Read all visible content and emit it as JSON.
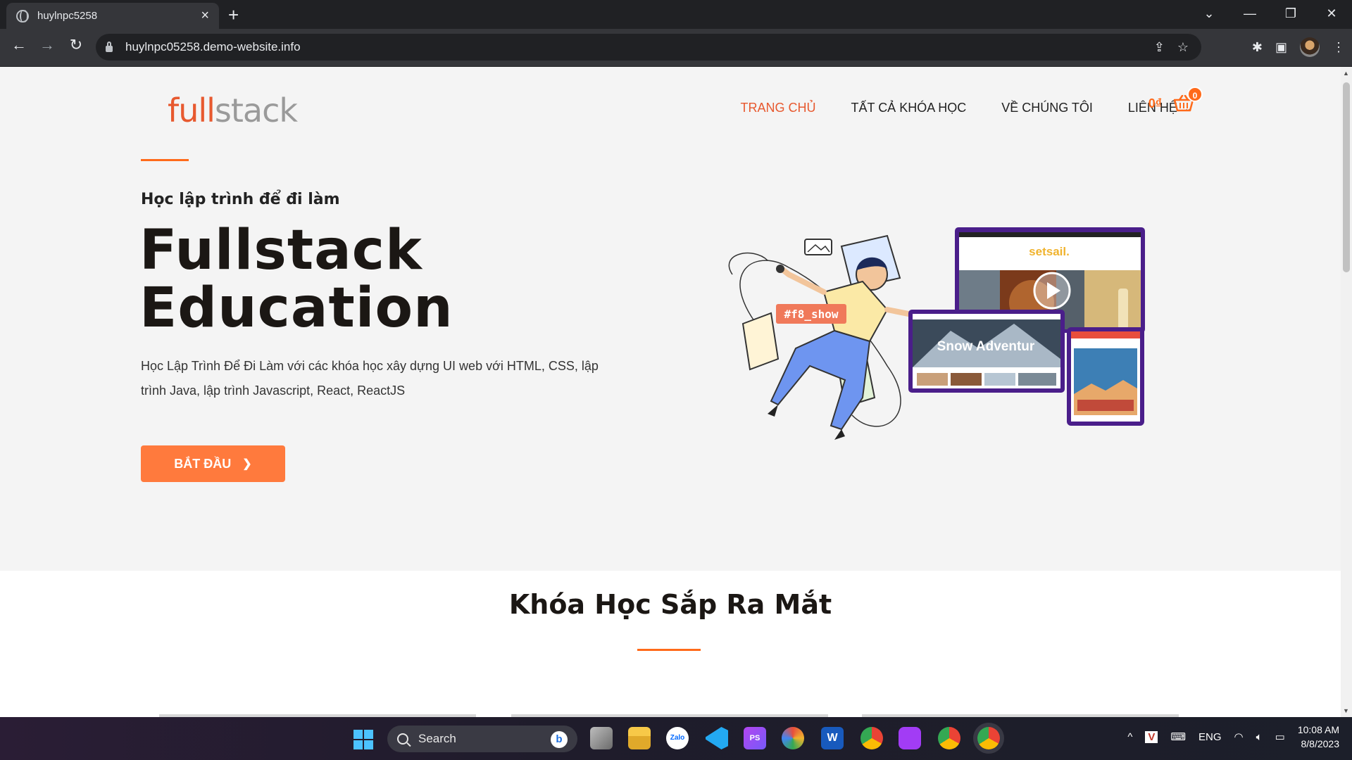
{
  "browser": {
    "tab_title": "huylnpc5258",
    "url": "huylnpc05258.demo-website.info"
  },
  "site": {
    "logo_full": "full",
    "logo_stack": "stack",
    "nav": [
      {
        "label": "TRANG CHỦ",
        "active": true
      },
      {
        "label": "TẤT CẢ KHÓA HỌC",
        "active": false
      },
      {
        "label": "VỀ CHÚNG TÔI",
        "active": false
      },
      {
        "label": "LIÊN HỆ",
        "active": false
      }
    ],
    "cart_amount": "0₫",
    "cart_count": "0"
  },
  "hero": {
    "tagline": "Học lập trình để đi làm",
    "title_line1": "Fullstack",
    "title_line2": "Education",
    "description": "Học Lập Trình Để Đi Làm với các khóa học xây dựng UI web với HTML, CSS, lập trình Java, lập trình Javascript, React, ReactJS",
    "cta_label": "BẮT ĐẦU",
    "illustration": {
      "hashtag": "#f8_show",
      "screen1_brand": "setsail.",
      "screen2_title": "Snow Adventur"
    }
  },
  "section": {
    "title": "Khóa Học Sắp Ra Mắt"
  },
  "taskbar": {
    "search_label": "Search",
    "language": "ENG",
    "time": "10:08 AM",
    "date": "8/8/2023"
  },
  "colors": {
    "accent": "#ff6a1a",
    "logo_orange": "#e7592f",
    "chrome_dark": "#202124"
  }
}
